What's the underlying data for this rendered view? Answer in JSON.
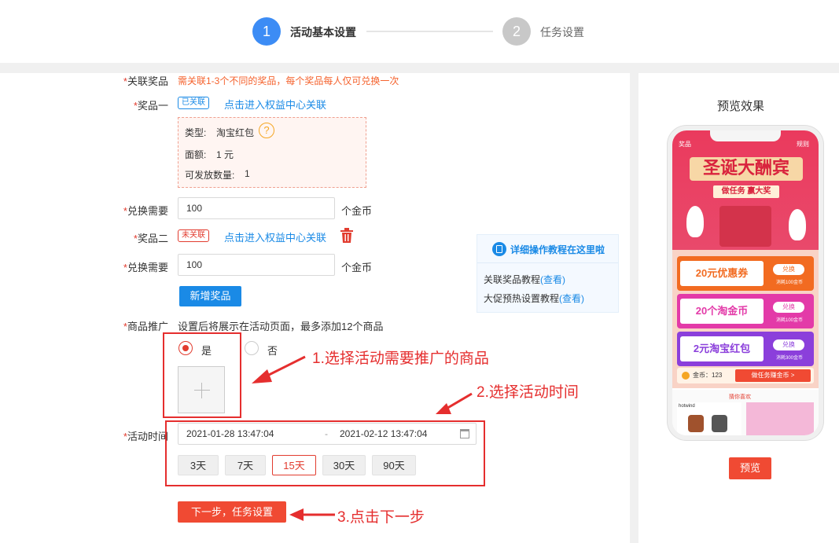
{
  "steps": [
    {
      "num": "1",
      "label": "活动基本设置",
      "active": true
    },
    {
      "num": "2",
      "label": "任务设置",
      "active": false
    }
  ],
  "form": {
    "link_prize": {
      "label": "关联奖品",
      "hint": "需关联1-3个不同的奖品，每个奖品每人仅可兑换一次"
    },
    "prize1": {
      "label": "奖品一",
      "tag": "已关联",
      "link": "点击进入权益中心关联",
      "type_label": "类型:",
      "type_value": "淘宝红包",
      "amount_label": "面额:",
      "amount_value": "1 元",
      "qty_label": "可发放数量:",
      "qty_value": "1"
    },
    "exchange1": {
      "label": "兑换需要",
      "value": "100",
      "unit": "个金币"
    },
    "prize2": {
      "label": "奖品二",
      "tag": "未关联",
      "link": "点击进入权益中心关联"
    },
    "exchange2": {
      "label": "兑换需要",
      "value": "100",
      "unit": "个金币"
    },
    "add_prize": "新增奖品",
    "promo": {
      "label": "商品推广",
      "hint": "设置后将展示在活动页面，最多添加12个商品",
      "yes": "是",
      "no": "否",
      "selected": "是"
    },
    "time": {
      "label": "活动时间",
      "start": "2021-01-28 13:47:04",
      "separator": "-",
      "end": "2021-02-12 13:47:04"
    },
    "days": [
      "3天",
      "7天",
      "15天",
      "30天",
      "90天"
    ],
    "active_day": "15天",
    "next_button": "下一步，任务设置"
  },
  "tutorial": {
    "title": "详细操作教程在这里啦",
    "items": [
      {
        "text": "关联奖品教程",
        "link": "(查看)"
      },
      {
        "text": "大促预热设置教程",
        "link": "(查看)"
      }
    ]
  },
  "annotations": {
    "a1": "1.选择活动需要推广的商品",
    "a2": "2.选择活动时间",
    "a3": "3.点击下一步"
  },
  "preview": {
    "title": "预览效果",
    "top_left": "奖品",
    "top_right": "规则",
    "banner_title": "圣诞大酬宾",
    "banner_sub": "做任务 赢大奖",
    "coupons": [
      {
        "text": "20元优惠券",
        "btn": "兑换",
        "note": "消耗100金币",
        "color": "#f26b21"
      },
      {
        "text": "20个淘金币",
        "btn": "兑换",
        "note": "消耗100金币",
        "color": "#e33aa8"
      },
      {
        "text": "2元淘宝红包",
        "btn": "兑换",
        "note": "消耗300金币",
        "color": "#8b3fdb"
      }
    ],
    "coins": "金币：123",
    "task_btn": "做任务赚金币 >",
    "recommend": "猜你喜欢",
    "brand": "hotwind",
    "button": "预览"
  },
  "colors": {
    "primary": "#1a8ae6",
    "danger": "#e23c2f",
    "step_active": "#3c8cf5"
  }
}
